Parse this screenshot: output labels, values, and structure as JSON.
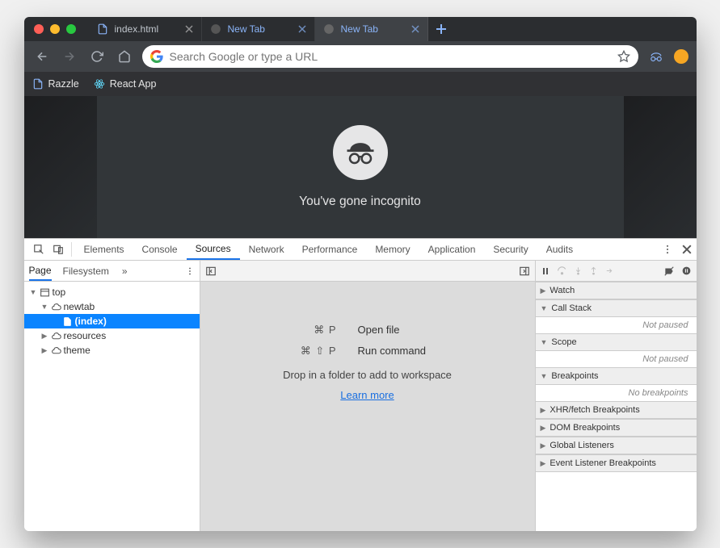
{
  "tabs": [
    {
      "title": "index.html",
      "type": "file"
    },
    {
      "title": "New Tab",
      "type": "incognito"
    },
    {
      "title": "New Tab",
      "type": "incognito",
      "active": true
    }
  ],
  "omnibox": {
    "placeholder": "Search Google or type a URL"
  },
  "bookmarks": [
    {
      "label": "Razzle",
      "icon": "file"
    },
    {
      "label": "React App",
      "icon": "atom"
    }
  ],
  "incognito": {
    "message": "You've gone incognito"
  },
  "devtools": {
    "main_tabs": [
      "Elements",
      "Console",
      "Sources",
      "Network",
      "Performance",
      "Memory",
      "Application",
      "Security",
      "Audits"
    ],
    "active_tab": "Sources",
    "left_tabs": [
      "Page",
      "Filesystem"
    ],
    "active_left": "Page",
    "tree": [
      {
        "depth": 0,
        "arrow": "down",
        "icon": "window",
        "label": "top"
      },
      {
        "depth": 1,
        "arrow": "down",
        "icon": "cloud",
        "label": "newtab"
      },
      {
        "depth": 2,
        "arrow": "",
        "icon": "file",
        "label": "(index)",
        "sel": true
      },
      {
        "depth": 1,
        "arrow": "right",
        "icon": "cloud",
        "label": "resources"
      },
      {
        "depth": 1,
        "arrow": "right",
        "icon": "cloud",
        "label": "theme"
      }
    ],
    "center": {
      "cmds": [
        {
          "keys": "⌘ P",
          "label": "Open file"
        },
        {
          "keys": "⌘ ⇧ P",
          "label": "Run command"
        }
      ],
      "drop": "Drop in a folder to add to workspace",
      "learn": "Learn more"
    },
    "right": {
      "sections": [
        {
          "title": "Watch",
          "body": null,
          "arrow": "right"
        },
        {
          "title": "Call Stack",
          "body": "Not paused",
          "arrow": "down"
        },
        {
          "title": "Scope",
          "body": "Not paused",
          "arrow": "down"
        },
        {
          "title": "Breakpoints",
          "body": "No breakpoints",
          "arrow": "down"
        },
        {
          "title": "XHR/fetch Breakpoints",
          "body": null,
          "arrow": "right"
        },
        {
          "title": "DOM Breakpoints",
          "body": null,
          "arrow": "right"
        },
        {
          "title": "Global Listeners",
          "body": null,
          "arrow": "right"
        },
        {
          "title": "Event Listener Breakpoints",
          "body": null,
          "arrow": "right"
        }
      ]
    }
  }
}
